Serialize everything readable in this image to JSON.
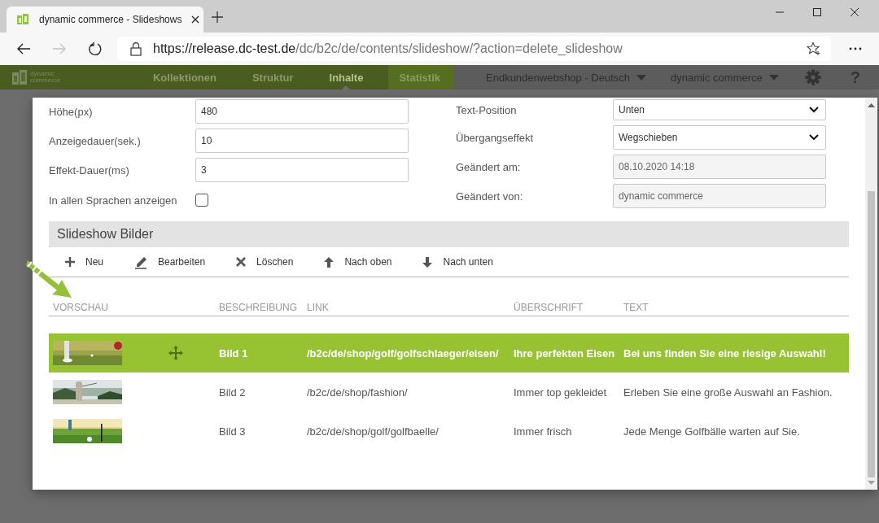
{
  "browser": {
    "tab_title": "dynamic commerce - Slideshows",
    "url_host": "https://release.dc-test.de",
    "url_path": "/dc/b2c/de/contents/slideshow/?action=delete_slideshow"
  },
  "app_nav": {
    "logo_lines": [
      "dynamic",
      "commerce"
    ],
    "items": [
      {
        "label": "Kollektionen",
        "selected": false,
        "highlighted": false
      },
      {
        "label": "Struktur",
        "selected": false,
        "highlighted": false
      },
      {
        "label": "Inhalte",
        "selected": true,
        "highlighted": false
      },
      {
        "label": "Statistik",
        "selected": false,
        "highlighted": true
      }
    ],
    "selectors": [
      "Endkundenwebshop - Deutsch",
      "dynamic commerce"
    ],
    "help": "?"
  },
  "form_left": [
    {
      "label": "Höhe(px)",
      "kind": "input",
      "value": "480"
    },
    {
      "label": "Anzeigedauer(sek.)",
      "kind": "input",
      "value": "10"
    },
    {
      "label": "Effekt-Dauer(ms)",
      "kind": "input",
      "value": "3"
    },
    {
      "label": "In allen Sprachen anzeigen",
      "kind": "checkbox",
      "checked": false
    }
  ],
  "form_right": [
    {
      "label": "Text-Position",
      "kind": "select",
      "value": "Unten"
    },
    {
      "label": "Übergangseffekt",
      "kind": "select",
      "value": "Wegschieben"
    },
    {
      "label": "Geändert am:",
      "kind": "readonly",
      "value": "08.10.2020 14:18"
    },
    {
      "label": "Geändert von:",
      "kind": "readonly",
      "value": "dynamic commerce"
    }
  ],
  "section_title": "Slideshow Bilder",
  "toolbar": [
    {
      "label": "Neu",
      "kind": "add"
    },
    {
      "label": "Bearbeiten",
      "kind": "edit"
    },
    {
      "label": "Löschen",
      "kind": "delete"
    },
    {
      "label": "Nach oben",
      "kind": "move_up"
    },
    {
      "label": "Nach unten",
      "kind": "move_down"
    }
  ],
  "table": {
    "columns": [
      "VORSCHAU",
      "BESCHREIBUNG",
      "LINK",
      "ÜBERSCHRIFT",
      "TEXT"
    ],
    "rows": [
      {
        "selected": true,
        "description": "Bild 1",
        "link": "/b2c/de/shop/golf/golfschlaeger/eisen/",
        "heading": "Ihre perfekten Eisen",
        "text": "Bei uns finden Sie eine riesige Auswahl!"
      },
      {
        "selected": false,
        "description": "Bild 2",
        "link": "/b2c/de/shop/fashion/",
        "heading": "Immer top gekleidet",
        "text": "Erleben Sie eine große Auswahl an Fashion."
      },
      {
        "selected": false,
        "description": "Bild 3",
        "link": "/b2c/de/shop/golf/golfbaelle/",
        "heading": "Immer frisch",
        "text": "Jede Menge Golfbälle warten auf Sie."
      }
    ]
  }
}
